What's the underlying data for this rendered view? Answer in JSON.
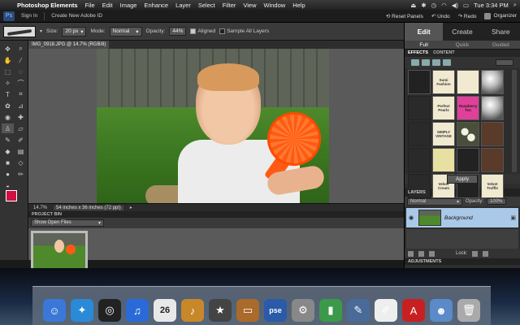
{
  "menubar": {
    "app_name": "Photoshop Elements",
    "items": [
      "File",
      "Edit",
      "Image",
      "Enhance",
      "Layer",
      "Select",
      "Filter",
      "View",
      "Window",
      "Help"
    ],
    "clock": "Tue 3:34 PM"
  },
  "appbar": {
    "sign_in": "Sign In",
    "create_id": "Create New Adobe ID",
    "reset_panels": "Reset Panels",
    "undo": "Undo",
    "redo": "Redo",
    "organizer": "Organizer"
  },
  "options": {
    "size_label": "Size:",
    "size_value": "20 px",
    "mode_label": "Mode:",
    "mode_value": "Normal",
    "opacity_label": "Opacity:",
    "opacity_value": "44%",
    "aligned_label": "Aligned",
    "sample_label": "Sample All Layers"
  },
  "document": {
    "tab_title": "IMG_0918.JPG @ 14.7% (RGB/8)",
    "zoom": "14.7%",
    "info": "54 inches x 36 inches (72 ppi)"
  },
  "project_bin": {
    "header": "PROJECT BIN",
    "filter": "Show Open Files"
  },
  "right_panel": {
    "modes": [
      "Edit",
      "Create",
      "Share"
    ],
    "submodes": [
      "Full",
      "Quick",
      "Guided"
    ],
    "panel_tabs": [
      "EFFECTS",
      "CONTENT"
    ],
    "effects": [
      {
        "label": "",
        "style": "dark"
      },
      {
        "label": "Sumi Fashion",
        "style": "cream"
      },
      {
        "label": "",
        "style": "cream"
      },
      {
        "label": "",
        "style": "sphere"
      },
      {
        "label": "",
        "style": "sep"
      },
      {
        "label": "Perfect Pearls",
        "style": "cream"
      },
      {
        "label": "Raspberry Tea",
        "style": "pink"
      },
      {
        "label": "",
        "style": "sphere"
      },
      {
        "label": "",
        "style": "sep"
      },
      {
        "label": "SIMPLY VINTAGE",
        "style": "cream"
      },
      {
        "label": "",
        "style": "flowers"
      },
      {
        "label": "",
        "style": "brown"
      },
      {
        "label": "",
        "style": "sep"
      },
      {
        "label": "",
        "style": "yellow"
      },
      {
        "label": "",
        "style": "dark"
      },
      {
        "label": "",
        "style": "brown"
      },
      {
        "label": "",
        "style": "sep"
      },
      {
        "label": "Velvet Cream",
        "style": "cream"
      },
      {
        "label": "",
        "style": "dark"
      },
      {
        "label": "Velvet Truffle",
        "style": "cream"
      }
    ],
    "apply": "Apply",
    "layers_header": "LAYERS",
    "blend_mode": "Normal",
    "opacity_label": "Opacity:",
    "opacity_value": "100%",
    "layer_name": "Background",
    "lock_label": "Lock:",
    "adjustments_header": "ADJUSTMENTS"
  },
  "dock": {
    "icons": [
      {
        "name": "finder-icon",
        "glyph": "☺",
        "color": "#3a78d8"
      },
      {
        "name": "safari-icon",
        "glyph": "✦",
        "color": "#2a8ad8"
      },
      {
        "name": "dashboard-icon",
        "glyph": "◎",
        "color": "#222"
      },
      {
        "name": "itunes-icon",
        "glyph": "♫",
        "color": "#2a6ad8"
      },
      {
        "name": "calendar-icon",
        "glyph": "26",
        "color": "#e8e8e8"
      },
      {
        "name": "garageband-icon",
        "glyph": "♪",
        "color": "#c8882a"
      },
      {
        "name": "imovie-icon",
        "glyph": "★",
        "color": "#444"
      },
      {
        "name": "keynote-icon",
        "glyph": "▭",
        "color": "#aa6a2a"
      },
      {
        "name": "photoshop-elements-icon",
        "glyph": "pse",
        "color": "#2a5aa8"
      },
      {
        "name": "system-preferences-icon",
        "glyph": "⚙",
        "color": "#888"
      },
      {
        "name": "numbers-icon",
        "glyph": "▮",
        "color": "#3a9a4a"
      },
      {
        "name": "text-edit-icon",
        "glyph": "✎",
        "color": "#4a6a9a"
      },
      {
        "name": "pages-icon",
        "glyph": "✐",
        "color": "#eee"
      },
      {
        "name": "acrobat-icon",
        "glyph": "A",
        "color": "#c82020"
      },
      {
        "name": "preview-icon",
        "glyph": "☻",
        "color": "#5a8ac8"
      },
      {
        "name": "trash-icon",
        "glyph": "🗑",
        "color": "#aaa"
      }
    ]
  }
}
